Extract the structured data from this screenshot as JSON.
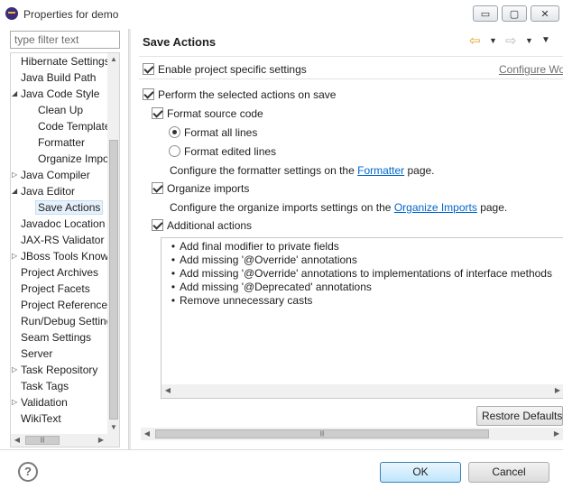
{
  "window": {
    "title": "Properties for demo",
    "minimize_glyph": "▭",
    "maximize_glyph": "▢",
    "close_glyph": "✕"
  },
  "left": {
    "filter_placeholder": "type filter text",
    "tree": [
      {
        "label": "Hibernate Settings",
        "arrow": ""
      },
      {
        "label": "Java Build Path",
        "arrow": ""
      },
      {
        "label": "Java Code Style",
        "arrow": "◢"
      },
      {
        "label": "Clean Up",
        "arrow": ""
      },
      {
        "label": "Code Templates",
        "arrow": ""
      },
      {
        "label": "Formatter",
        "arrow": ""
      },
      {
        "label": "Organize Imports",
        "arrow": ""
      },
      {
        "label": "Java Compiler",
        "arrow": "▷"
      },
      {
        "label": "Java Editor",
        "arrow": "◢"
      },
      {
        "label": "Save Actions",
        "arrow": ""
      },
      {
        "label": "Javadoc Location",
        "arrow": ""
      },
      {
        "label": "JAX-RS Validator",
        "arrow": ""
      },
      {
        "label": "JBoss Tools Knowledge",
        "arrow": "▷"
      },
      {
        "label": "Project Archives",
        "arrow": ""
      },
      {
        "label": "Project Facets",
        "arrow": ""
      },
      {
        "label": "Project References",
        "arrow": ""
      },
      {
        "label": "Run/Debug Settings",
        "arrow": ""
      },
      {
        "label": "Seam Settings",
        "arrow": ""
      },
      {
        "label": "Server",
        "arrow": ""
      },
      {
        "label": "Task Repository",
        "arrow": "▷"
      },
      {
        "label": "Task Tags",
        "arrow": ""
      },
      {
        "label": "Validation",
        "arrow": "▷"
      },
      {
        "label": "WikiText",
        "arrow": ""
      }
    ],
    "scroll_up": "▲",
    "scroll_down": "▼",
    "scroll_left": "◀",
    "scroll_right": "▶",
    "thumb_grip": "|||"
  },
  "right": {
    "title": "Save Actions",
    "nav_back": "⇦",
    "nav_forward": "⇨",
    "nav_caret": "▼",
    "nav_menu": "▼",
    "enable_project_specific": "Enable project specific settings",
    "configure_workspace": "Configure Workspace Settings...",
    "perform_on_save": "Perform the selected actions on save",
    "format_source": "Format source code",
    "format_all": "Format all lines",
    "format_edited": "Format edited lines",
    "formatter_text_before": "Configure the formatter settings on the ",
    "formatter_link": "Formatter",
    "formatter_text_after": " page.",
    "organize_imports": "Organize imports",
    "organize_text_before": "Configure the organize imports settings on the ",
    "organize_link": "Organize Imports",
    "organize_text_after": " page.",
    "additional_actions": "Additional actions",
    "actions": [
      "Add final modifier to private fields",
      "Add missing '@Override' annotations",
      "Add missing '@Override' annotations to implementations of interface methods",
      "Add missing '@Deprecated' annotations",
      "Remove unnecessary casts"
    ],
    "restore_defaults": "Restore Defaults",
    "thumb_grip": "|||"
  },
  "bottom": {
    "help": "?",
    "ok": "OK",
    "cancel": "Cancel"
  }
}
